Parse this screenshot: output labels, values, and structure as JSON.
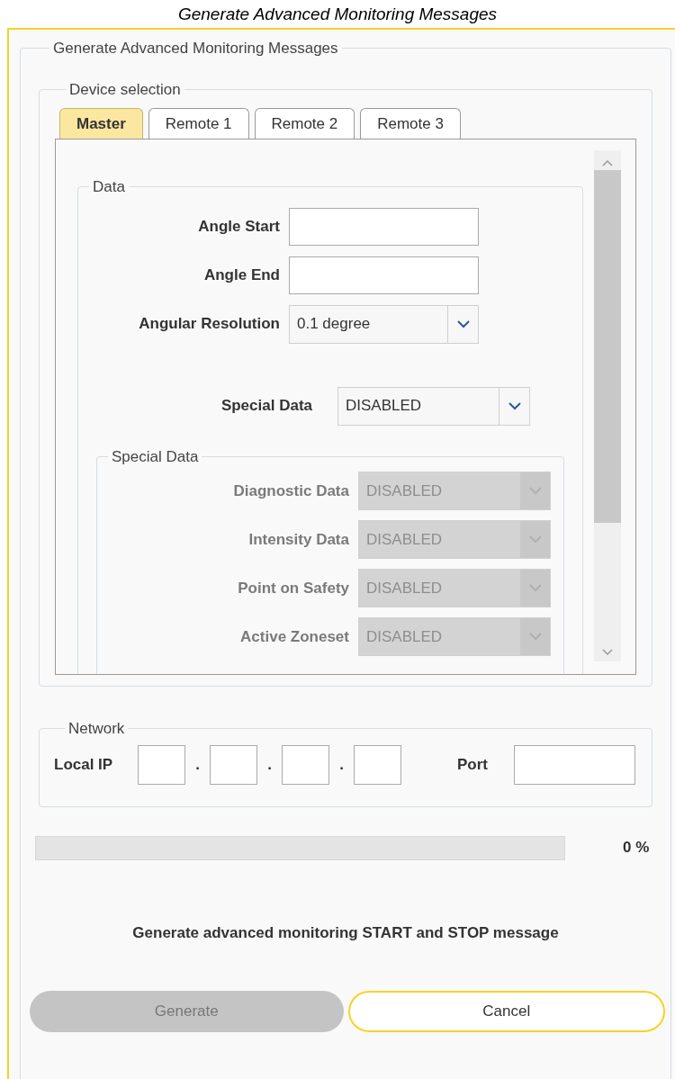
{
  "caption": "Generate Advanced Monitoring Messages",
  "group_title": "Generate Advanced Monitoring Messages",
  "device_selection": {
    "legend": "Device selection",
    "tabs": [
      {
        "label": "Master",
        "selected": true
      },
      {
        "label": "Remote 1",
        "selected": false
      },
      {
        "label": "Remote 2",
        "selected": false
      },
      {
        "label": "Remote 3",
        "selected": false
      }
    ],
    "data_group": {
      "legend": "Data",
      "fields": [
        {
          "label": "Angle Start",
          "kind": "text"
        },
        {
          "label": "Angle End",
          "kind": "text"
        },
        {
          "label": "Angular Resolution",
          "kind": "dropdown",
          "value": "0.1 degree"
        }
      ],
      "special_data": {
        "label": "Special Data",
        "value": "DISABLED"
      },
      "special_group": {
        "legend": "Special Data",
        "rows": [
          {
            "label": "Diagnostic Data",
            "value": "DISABLED",
            "disabled": true
          },
          {
            "label": "Intensity Data",
            "value": "DISABLED",
            "disabled": true
          },
          {
            "label": "Point on Safety",
            "value": "DISABLED",
            "disabled": true
          },
          {
            "label": "Active Zoneset",
            "value": "DISABLED",
            "disabled": true
          }
        ]
      }
    }
  },
  "network": {
    "legend": "Network",
    "local_ip_label": "Local IP",
    "separators": [
      ".",
      ".",
      "."
    ],
    "port_label": "Port"
  },
  "progress": {
    "level": 0,
    "reading": "0 %"
  },
  "message": "Generate advanced monitoring START and STOP message",
  "buttons": [
    {
      "label": "Generate",
      "disabled": true
    },
    {
      "label": "Cancel",
      "disabled": false
    }
  ]
}
